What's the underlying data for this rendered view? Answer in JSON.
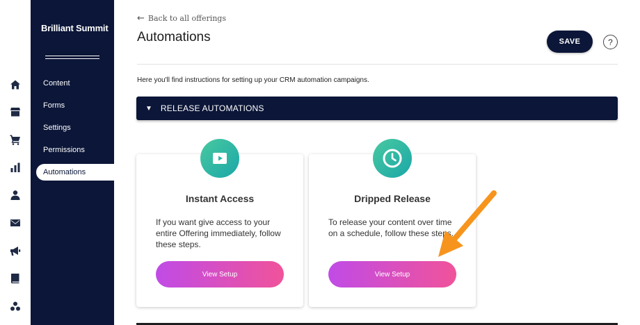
{
  "rail": {
    "icons": [
      "home-icon",
      "store-icon",
      "cart-icon",
      "bar-chart-icon",
      "user-icon",
      "mail-icon",
      "megaphone-icon",
      "book-icon",
      "community-icon"
    ]
  },
  "sidebar": {
    "brand": "Brilliant Summit",
    "items": [
      {
        "label": "Content"
      },
      {
        "label": "Forms"
      },
      {
        "label": "Settings"
      },
      {
        "label": "Permissions"
      },
      {
        "label": "Automations"
      }
    ],
    "active_item": "Automations"
  },
  "header": {
    "back_label": "Back to all offerings",
    "title": "Automations",
    "save_label": "SAVE",
    "help_label": "?"
  },
  "main": {
    "intro": "Here you'll find instructions for setting up your CRM automation campaigns.",
    "accordion_label": "RELEASE AUTOMATIONS",
    "cards": [
      {
        "icon": "play-icon",
        "title": "Instant Access",
        "description": "If you want give access to your entire Offering immediately, follow these steps.",
        "button_label": "View Setup"
      },
      {
        "icon": "clock-icon",
        "title": "Dripped Release",
        "description": "To release your content over time on a schedule, follow these steps.",
        "button_label": "View Setup"
      }
    ]
  },
  "colors": {
    "navy": "#0b1638",
    "badge_gradient": [
      "#49c9a0",
      "#1aa7a8"
    ],
    "button_gradient": [
      "#c04be6",
      "#f0539a"
    ],
    "annotation_arrow": "#f7941d"
  }
}
